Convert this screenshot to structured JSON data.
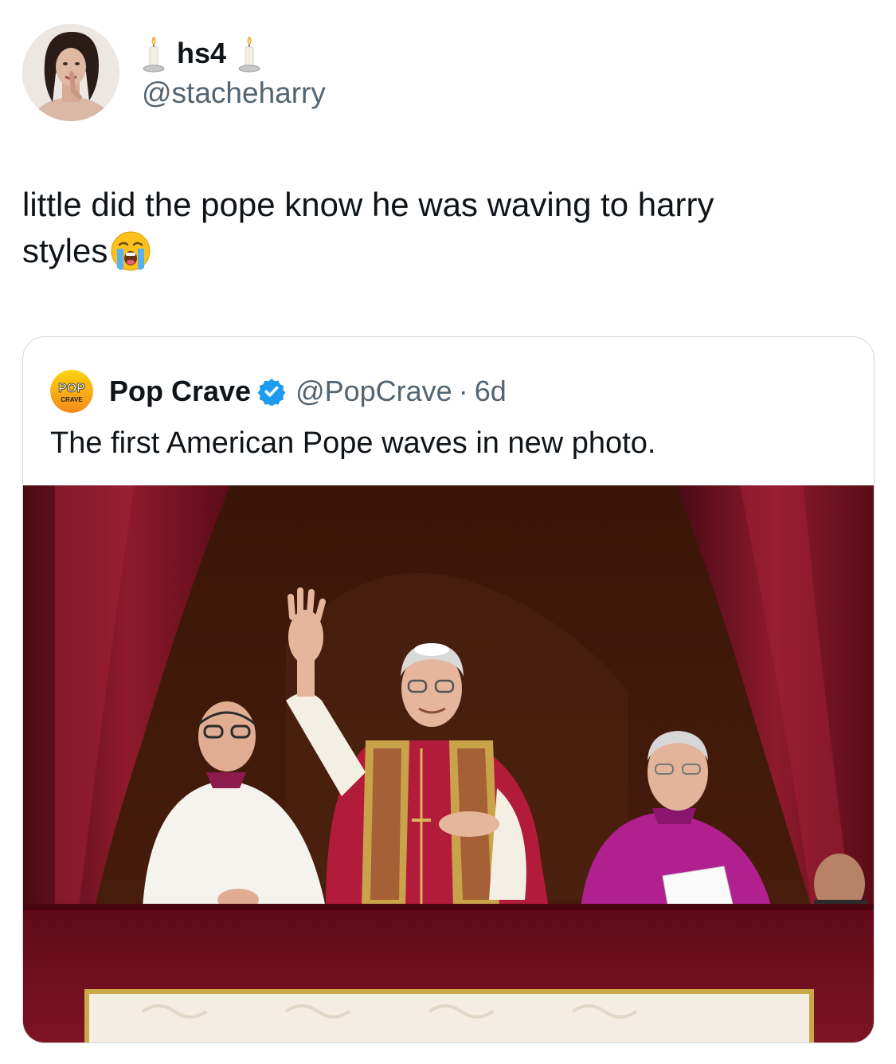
{
  "tweet": {
    "display_name": "hs4",
    "display_name_emoji": "candle",
    "handle": "@stacheharry",
    "text_line1": "little did the pope know he was waving to harry",
    "text_line2": "styles",
    "text_emoji": "loudly-crying-face"
  },
  "quote": {
    "avatar_logo": "POP CRAVE",
    "name": "Pop Crave",
    "verified": true,
    "handle": "@PopCrave",
    "separator": "·",
    "time": "6d",
    "text": "The first American Pope waves in new photo."
  },
  "colors": {
    "text_primary": "#0f1419",
    "text_secondary": "#536471",
    "border": "#cfd9de",
    "verified_blue": "#1d9bf0",
    "curtain_red": "#7a1020",
    "papal_red": "#b31b3a",
    "bishop_magenta": "#b0208f"
  }
}
